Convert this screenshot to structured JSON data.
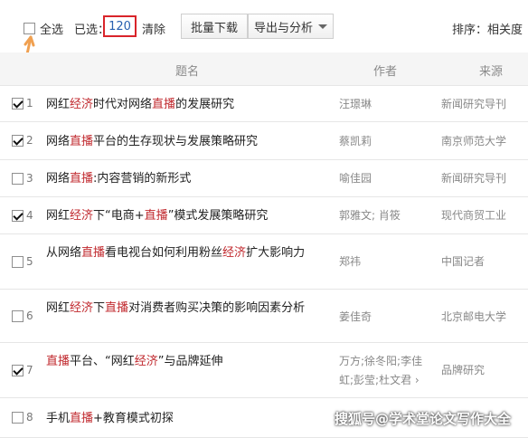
{
  "toolbar": {
    "select_all_label": "全选",
    "selected_prefix": "已选：",
    "selected_count": "120",
    "clear_label": "清除",
    "batch_download_label": "批量下载",
    "export_label": "导出与分析",
    "sort_label": "排序：相关度"
  },
  "table": {
    "headers": {
      "title": "题名",
      "author": "作者",
      "source": "来源"
    },
    "rows": [
      {
        "num": "1",
        "checked": true,
        "title": [
          {
            "t": "网红"
          },
          {
            "t": "经济",
            "hl": true
          },
          {
            "t": "时代对网络"
          },
          {
            "t": "直播",
            "hl": true
          },
          {
            "t": "的发展研究"
          }
        ],
        "author": "汪璟琳",
        "source": "新闻研究导刊"
      },
      {
        "num": "2",
        "checked": true,
        "title": [
          {
            "t": "网络"
          },
          {
            "t": "直播",
            "hl": true
          },
          {
            "t": "平台的生存现状与发展策略研究"
          }
        ],
        "author": "蔡凯莉",
        "source": "南京师范大学"
      },
      {
        "num": "3",
        "checked": false,
        "title": [
          {
            "t": "网络"
          },
          {
            "t": "直播",
            "hl": true
          },
          {
            "t": ":内容营销的新形式"
          }
        ],
        "author": "喻佳园",
        "source": "新闻研究导刊"
      },
      {
        "num": "4",
        "checked": true,
        "title": [
          {
            "t": "网红"
          },
          {
            "t": "经济",
            "hl": true
          },
          {
            "t": "下“电商+"
          },
          {
            "t": "直播",
            "hl": true
          },
          {
            "t": "”模式发展策略研究"
          }
        ],
        "author": "郭雅文; 肖筱",
        "source": "现代商贸工业"
      },
      {
        "num": "5",
        "checked": false,
        "title": [
          {
            "t": "从网络"
          },
          {
            "t": "直播",
            "hl": true
          },
          {
            "t": "看电视台如何利用粉丝"
          },
          {
            "t": "经济",
            "hl": true
          },
          {
            "t": "扩大影响力"
          }
        ],
        "author": "郑祎",
        "source": "中国记者"
      },
      {
        "num": "6",
        "checked": false,
        "title": [
          {
            "t": "网红"
          },
          {
            "t": "经济",
            "hl": true
          },
          {
            "t": "下"
          },
          {
            "t": "直播",
            "hl": true
          },
          {
            "t": "对消费者购买决策的影响因素分析"
          }
        ],
        "author": "姜佳奇",
        "source": "北京邮电大学"
      },
      {
        "num": "7",
        "checked": true,
        "title": [
          {
            "t": "直播",
            "hl": true
          },
          {
            "t": "平台、“网红"
          },
          {
            "t": "经济",
            "hl": true
          },
          {
            "t": "”与品牌延伸"
          }
        ],
        "author": "万方;徐冬阳;李佳虹;彭莹;杜文君 ›",
        "source": "品牌研究"
      },
      {
        "num": "8",
        "checked": false,
        "title": [
          {
            "t": "手机"
          },
          {
            "t": "直播",
            "hl": true
          },
          {
            "t": "+教育模式初探"
          }
        ],
        "author": "",
        "source": ""
      }
    ]
  },
  "watermark": "搜狐号@学术堂论文写作大全",
  "colors": {
    "highlight": "#c0282d",
    "count_border": "#d9242a",
    "count_text": "#2860b0",
    "arrow": "#f0a050"
  },
  "icons": {
    "arrow": "orange-arrow-icon",
    "caret": "caret-down-icon",
    "checkbox": "checkbox-icon"
  }
}
